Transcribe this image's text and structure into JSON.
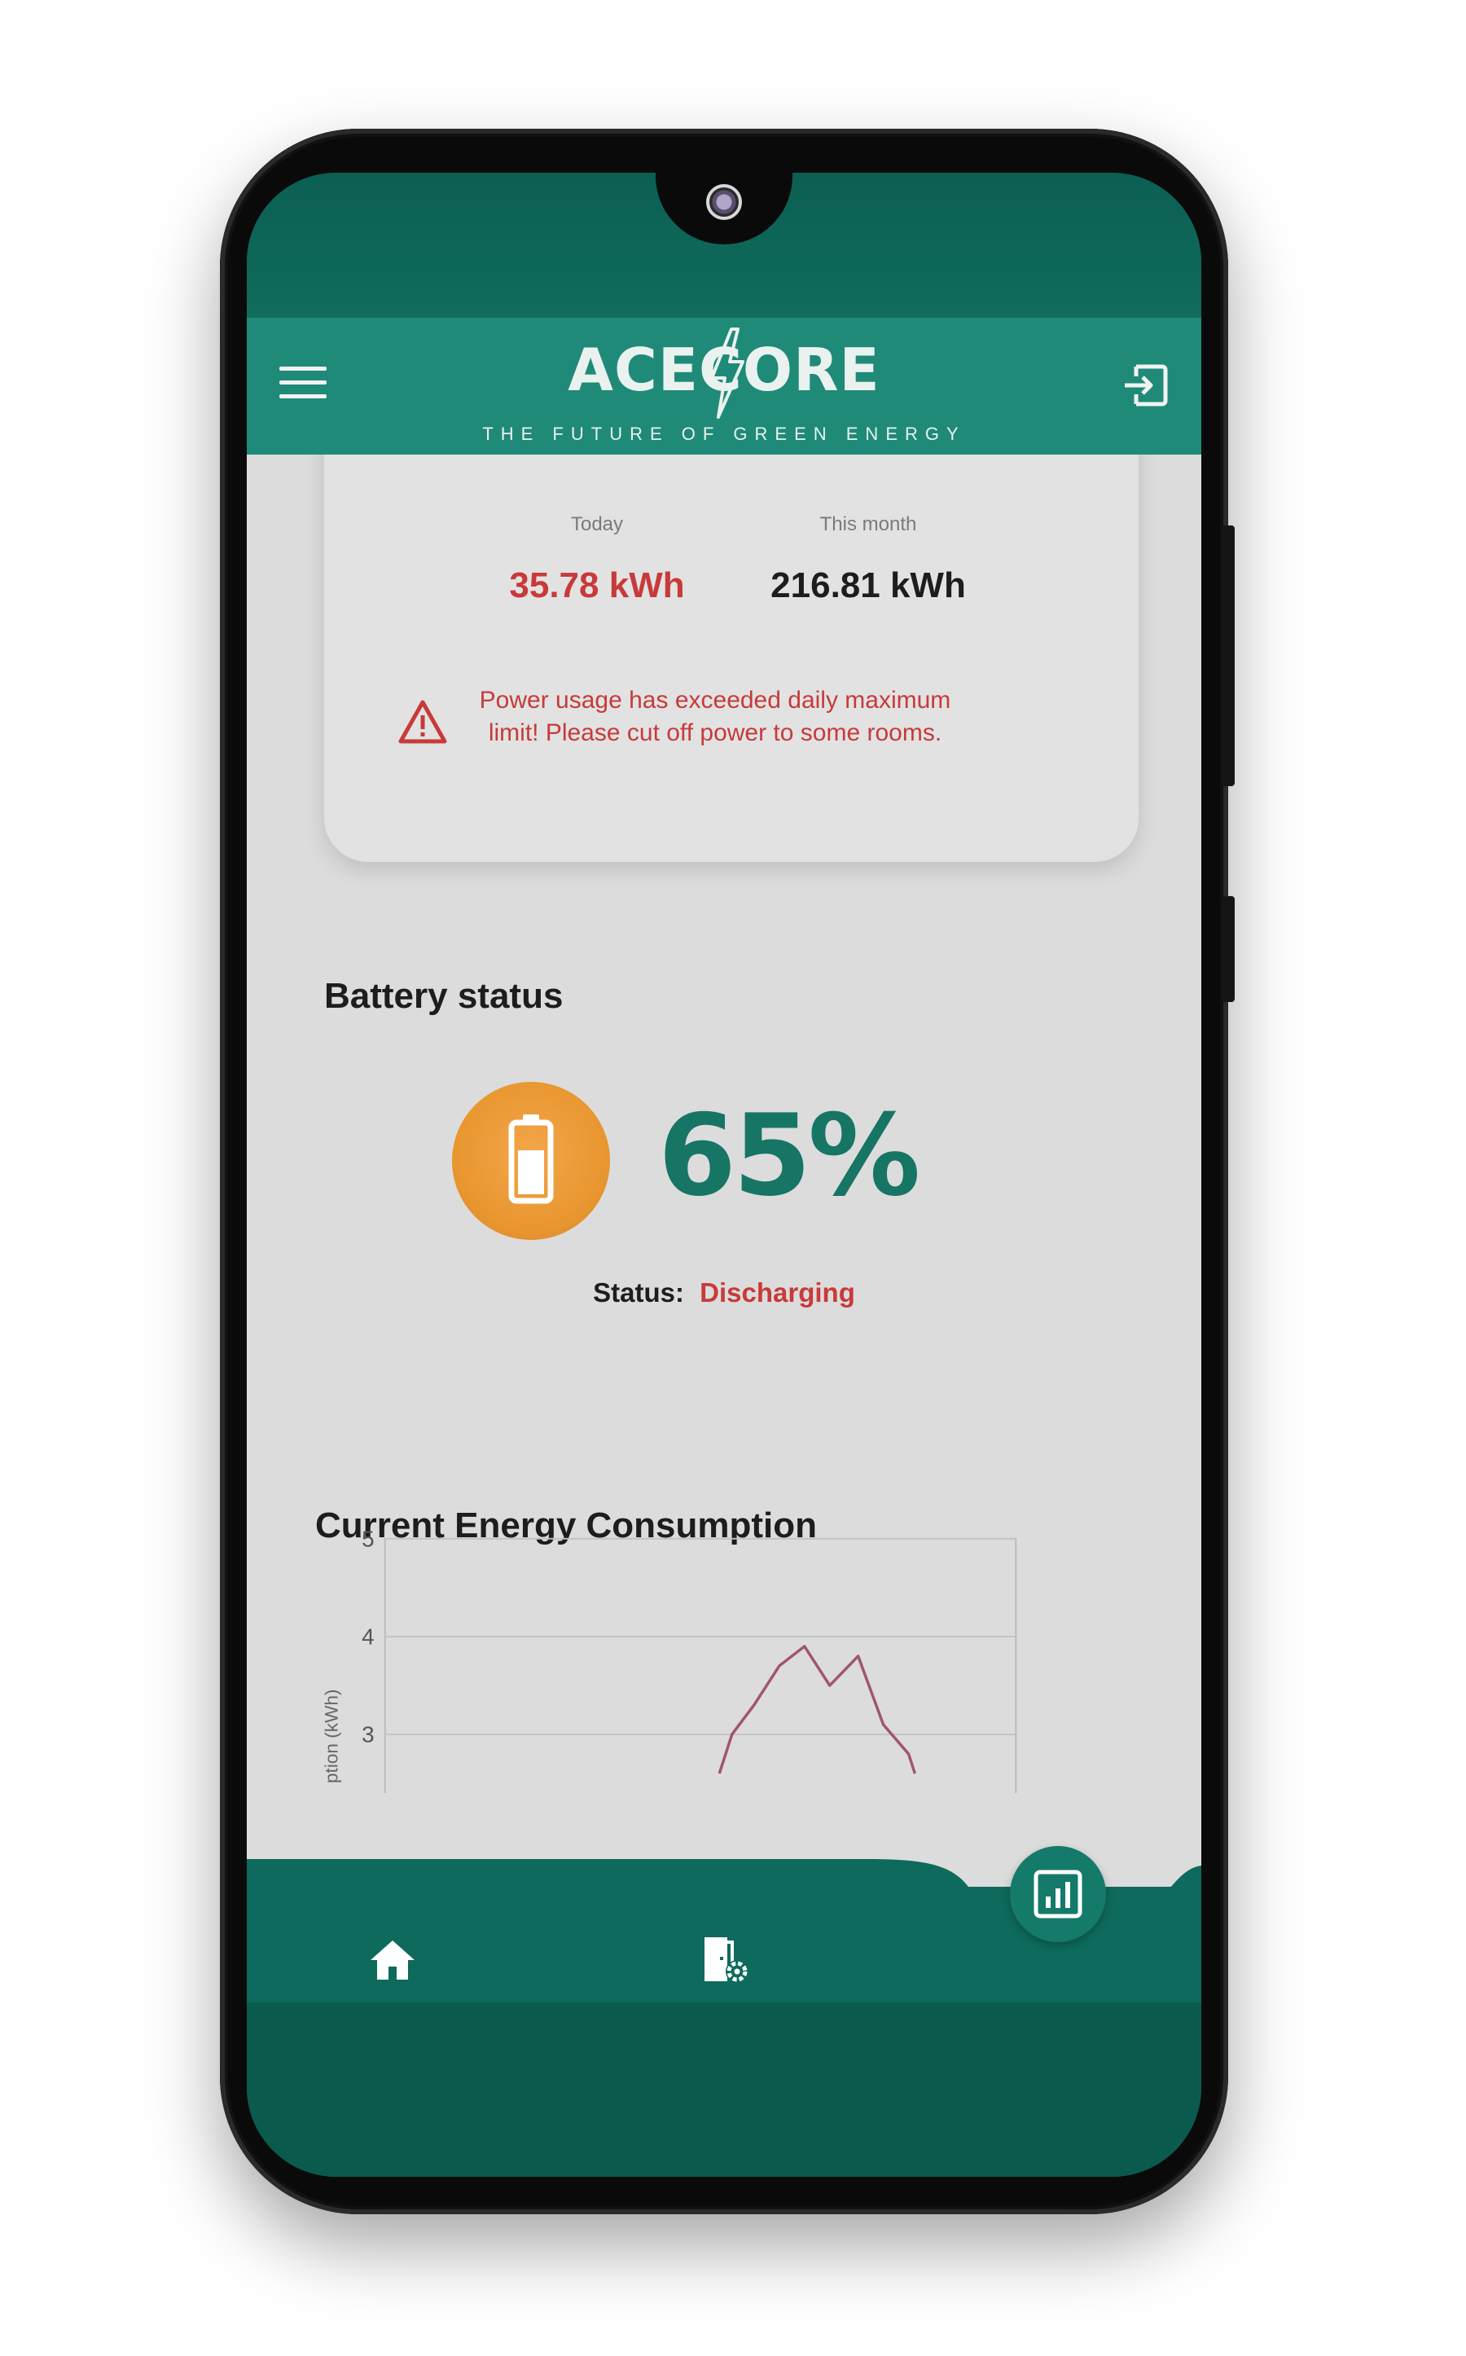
{
  "header": {
    "logo_text": "ACECORE",
    "tagline": "THE FUTURE OF GREEN ENERGY"
  },
  "usage": {
    "today_label": "Today",
    "today_value": "35.78 kWh",
    "month_label": "This month",
    "month_value": "216.81 kWh",
    "warning": "Power usage has exceeded daily maximum limit! Please cut off power to some rooms."
  },
  "battery": {
    "title": "Battery status",
    "percent": "65%",
    "status_label": "Status:",
    "status_value": "Discharging"
  },
  "consumption": {
    "title": "Current Energy Consumption"
  },
  "chart_data": {
    "type": "line",
    "ylabel": "ption (kWh)",
    "y_ticks": [
      "5",
      "4",
      "3"
    ],
    "ylim_visible": [
      2.7,
      5
    ],
    "series": [
      {
        "values": [
          {
            "x": 0.53,
            "y": 2.6
          },
          {
            "x": 0.55,
            "y": 3.0
          },
          {
            "x": 0.585,
            "y": 3.3
          },
          {
            "x": 0.625,
            "y": 3.7
          },
          {
            "x": 0.665,
            "y": 3.9
          },
          {
            "x": 0.705,
            "y": 3.5
          },
          {
            "x": 0.75,
            "y": 3.8
          },
          {
            "x": 0.79,
            "y": 3.1
          },
          {
            "x": 0.83,
            "y": 2.8
          },
          {
            "x": 0.84,
            "y": 2.6
          }
        ]
      }
    ],
    "line_color": "#a0566c",
    "grid": true
  },
  "colors": {
    "header": "#1f8a78",
    "nav": "#0d6a5c",
    "accent_red": "#c83a3a",
    "battery_orange": "#e8962f",
    "battery_text": "#167565"
  },
  "icons": {
    "menu": "hamburger-menu-icon",
    "logout": "logout-icon",
    "warning": "warning-triangle-icon",
    "battery": "battery-icon",
    "home": "home-icon",
    "settings": "room-settings-icon",
    "analytics": "analytics-chart-icon"
  }
}
